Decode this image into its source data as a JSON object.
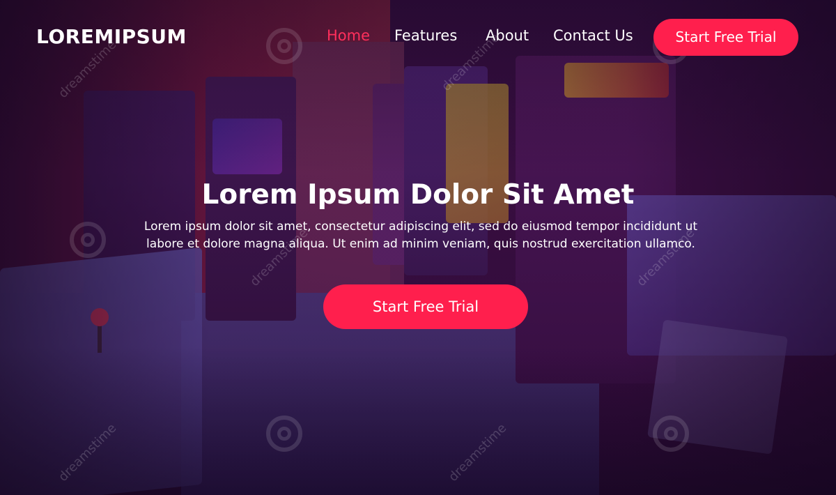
{
  "brand": {
    "logo_text": "LOREMIPSUM"
  },
  "nav": {
    "items": [
      {
        "label": "Home",
        "active": true
      },
      {
        "label": "Features",
        "active": false
      },
      {
        "label": "About",
        "active": false
      },
      {
        "label": "Contact Us",
        "active": false
      }
    ],
    "cta_label": "Start Free Trial"
  },
  "hero": {
    "title": "Lorem Ipsum Dolor Sit Amet",
    "subtitle": "Lorem ipsum dolor sit amet, consectetur adipiscing elit, sed do eiusmod tempor incididunt ut labore et dolore magna aliqua. Ut enim ad minim veniam, quis nostrud exercitation ullamco.",
    "cta_label": "Start Free Trial"
  },
  "watermark": {
    "text": "dreamstime"
  },
  "colors": {
    "accent": "#ff1f4d",
    "nav_active": "#ff2f5c",
    "text": "#ffffff"
  }
}
